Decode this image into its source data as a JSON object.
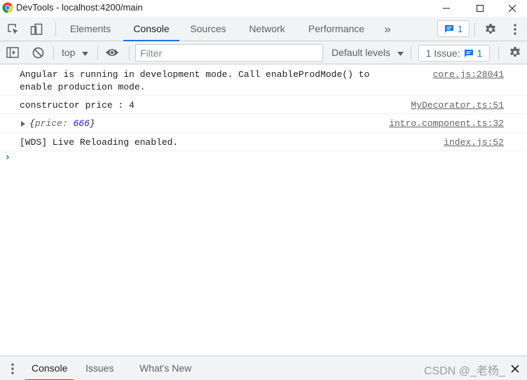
{
  "window": {
    "title": "DevTools - localhost:4200/main"
  },
  "tabs": {
    "items": [
      "Elements",
      "Console",
      "Sources",
      "Network",
      "Performance"
    ],
    "active": "Console",
    "more_label": "»",
    "messages_count": "1"
  },
  "console_toolbar": {
    "context": "top",
    "filter_placeholder": "Filter",
    "levels_label": "Default levels",
    "issue_label": "1 Issue:",
    "issue_count": "1"
  },
  "log": [
    {
      "message_line1": "Angular is running in development mode. Call enableProdMode() to",
      "message_line2": "enable production mode.",
      "source": "core.js:28041"
    },
    {
      "message": "constructor price : 4",
      "source": "MyDecorator.ts:51"
    },
    {
      "object_open": "{",
      "object_key": "price",
      "object_sep": ": ",
      "object_value": "666",
      "object_close": "}",
      "source": "intro.component.ts:32"
    },
    {
      "message": "[WDS] Live Reloading enabled.",
      "source": "index.js:52"
    }
  ],
  "prompt_symbol": "›",
  "drawer": {
    "tabs": [
      "Console",
      "Issues",
      "What's New"
    ],
    "active": "Console"
  },
  "watermark": "CSDN @_老杨_",
  "colors": {
    "accent": "#1a73e8",
    "toolbar_bg": "#f1f3f4",
    "border": "#cbcdd1",
    "number": "#1a1aa6"
  }
}
